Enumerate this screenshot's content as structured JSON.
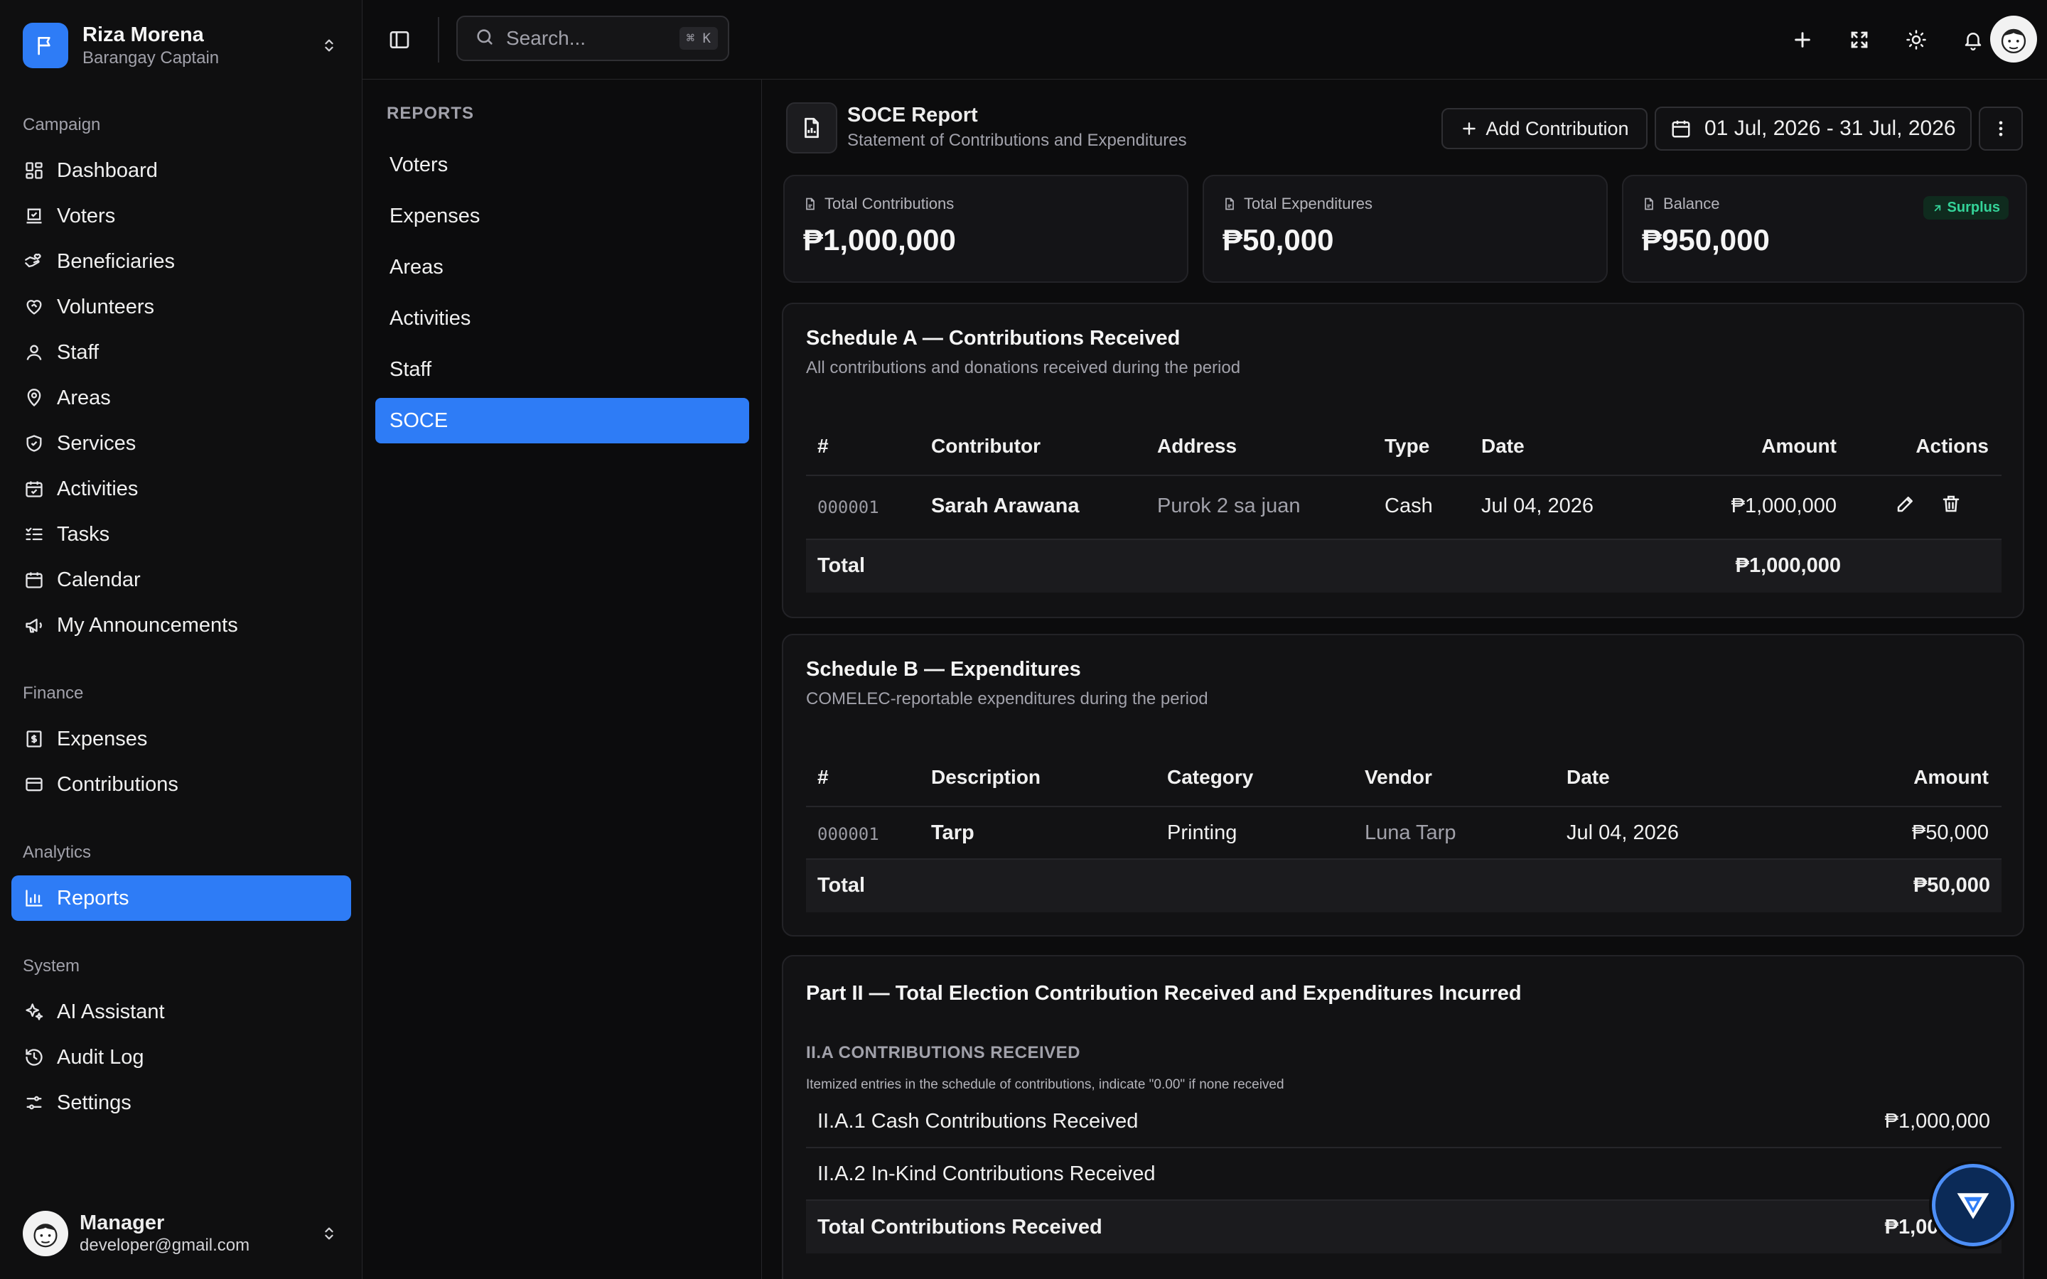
{
  "workspace": {
    "name": "Riza Morena",
    "role": "Barangay Captain"
  },
  "nav": {
    "campaign_label": "Campaign",
    "campaign": [
      {
        "label": "Dashboard"
      },
      {
        "label": "Voters"
      },
      {
        "label": "Beneficiaries"
      },
      {
        "label": "Volunteers"
      },
      {
        "label": "Staff"
      },
      {
        "label": "Areas"
      },
      {
        "label": "Services"
      },
      {
        "label": "Activities"
      },
      {
        "label": "Tasks"
      },
      {
        "label": "Calendar"
      },
      {
        "label": "My Announcements"
      }
    ],
    "finance_label": "Finance",
    "finance": [
      {
        "label": "Expenses"
      },
      {
        "label": "Contributions"
      }
    ],
    "analytics_label": "Analytics",
    "analytics": [
      {
        "label": "Reports",
        "active": true
      }
    ],
    "system_label": "System",
    "system": [
      {
        "label": "AI Assistant"
      },
      {
        "label": "Audit Log"
      },
      {
        "label": "Settings"
      }
    ]
  },
  "user": {
    "name": "Manager",
    "email": "developer@gmail.com"
  },
  "topbar": {
    "search_placeholder": "Search...",
    "shortcut": "⌘ K"
  },
  "reports_panel": {
    "title": "REPORTS",
    "items": [
      {
        "label": "Voters"
      },
      {
        "label": "Expenses"
      },
      {
        "label": "Areas"
      },
      {
        "label": "Activities"
      },
      {
        "label": "Staff"
      },
      {
        "label": "SOCE",
        "active": true
      }
    ]
  },
  "header": {
    "title": "SOCE Report",
    "subtitle": "Statement of Contributions and Expenditures",
    "add_button": "Add Contribution",
    "date_range": "01 Jul, 2026 - 31 Jul, 2026"
  },
  "stats": {
    "contributions": {
      "label": "Total Contributions",
      "value": "₱1,000,000"
    },
    "expenditures": {
      "label": "Total Expenditures",
      "value": "₱50,000"
    },
    "balance": {
      "label": "Balance",
      "value": "₱950,000",
      "badge": "Surplus"
    }
  },
  "schedule_a": {
    "title": "Schedule A — Contributions Received",
    "subtitle": "All contributions and donations received during the period",
    "headers": {
      "num": "#",
      "contributor": "Contributor",
      "address": "Address",
      "type": "Type",
      "date": "Date",
      "amount": "Amount",
      "actions": "Actions"
    },
    "rows": [
      {
        "num": "000001",
        "contributor": "Sarah Arawana",
        "address": "Purok 2 sa juan",
        "type": "Cash",
        "date": "Jul 04, 2026",
        "amount": "₱1,000,000"
      }
    ],
    "total_label": "Total",
    "total": "₱1,000,000"
  },
  "schedule_b": {
    "title": "Schedule B — Expenditures",
    "subtitle": "COMELEC-reportable expenditures during the period",
    "headers": {
      "num": "#",
      "description": "Description",
      "category": "Category",
      "vendor": "Vendor",
      "date": "Date",
      "amount": "Amount"
    },
    "rows": [
      {
        "num": "000001",
        "description": "Tarp",
        "category": "Printing",
        "vendor": "Luna Tarp",
        "date": "Jul 04, 2026",
        "amount": "₱50,000"
      }
    ],
    "total_label": "Total",
    "total": "₱50,000"
  },
  "part2": {
    "title": "Part II — Total Election Contribution Received and Expenditures Incurred",
    "section_title": "II.A CONTRIBUTIONS RECEIVED",
    "note": "Itemized entries in the schedule of contributions, indicate \"0.00\" if none received",
    "rows": [
      {
        "label": "II.A.1 Cash Contributions Received",
        "amount": "₱1,000,000"
      },
      {
        "label": "II.A.2 In-Kind Contributions Received",
        "amount": ""
      },
      {
        "label": "Total Contributions Received",
        "amount": "₱1,000,000"
      }
    ]
  },
  "colors": {
    "accent": "#2e7cf6",
    "surplus": "#34d399",
    "background": "#0c0c0d"
  }
}
